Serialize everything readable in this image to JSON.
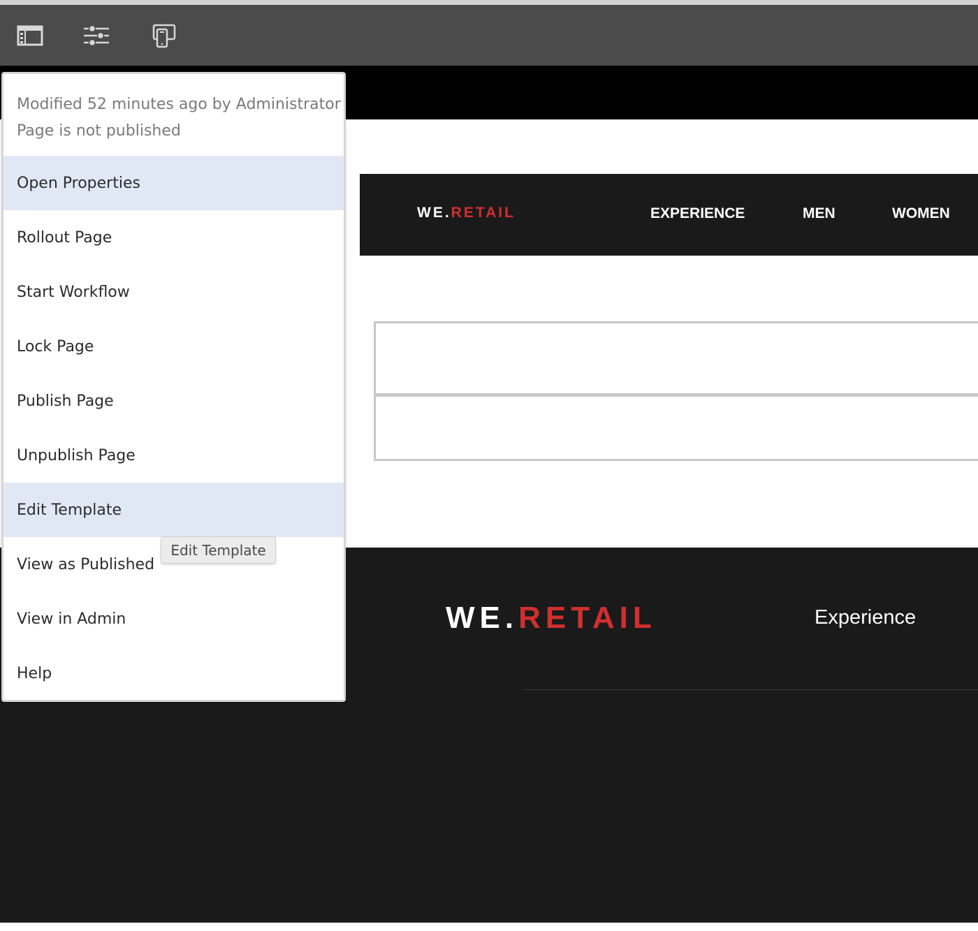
{
  "toolbar": {
    "buttons": [
      {
        "name": "toggle-side-panel",
        "icon": "side-panel-icon"
      },
      {
        "name": "page-properties",
        "icon": "sliders-icon"
      },
      {
        "name": "emulator",
        "icon": "devices-icon"
      }
    ]
  },
  "menu": {
    "info": {
      "modified": "Modified 52 minutes ago by Administrator",
      "status": "Page is not published"
    },
    "items": [
      {
        "label": "Open Properties",
        "highlighted": true
      },
      {
        "label": "Rollout Page",
        "highlighted": false
      },
      {
        "label": "Start Workflow",
        "highlighted": false
      },
      {
        "label": "Lock Page",
        "highlighted": false
      },
      {
        "label": "Publish Page",
        "highlighted": false
      },
      {
        "label": "Unpublish Page",
        "highlighted": false
      },
      {
        "label": "Edit Template",
        "highlighted": true
      },
      {
        "label": "View as Published",
        "highlighted": false
      },
      {
        "label": "View in Admin",
        "highlighted": false
      },
      {
        "label": "Help",
        "highlighted": false
      }
    ],
    "tooltip": "Edit Template"
  },
  "site": {
    "brand": {
      "part1": "WE",
      "dot": ".",
      "part2": "RETAIL"
    },
    "nav": [
      "EXPERIENCE",
      "MEN",
      "WOMEN"
    ],
    "footer": {
      "link": "Experience"
    }
  },
  "colors": {
    "toolbar": "#4b4b4b",
    "accent_red": "#d12f2f",
    "menu_highlight": "#e1e8f5",
    "site_dark": "#1a1a1a"
  }
}
